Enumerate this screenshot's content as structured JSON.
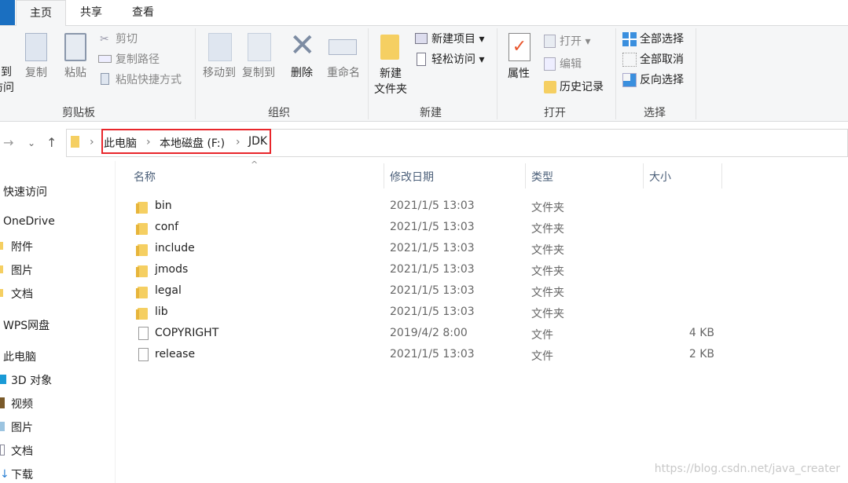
{
  "tabs": [
    "主页",
    "共享",
    "查看"
  ],
  "ribbon": {
    "pin": [
      "到",
      "访问"
    ],
    "copy": "复制",
    "paste": "粘贴",
    "cut": "剪切",
    "copy_path": "复制路径",
    "paste_shortcut": "粘贴快捷方式",
    "group_clipboard": "剪贴板",
    "move_to": "移动到",
    "copy_to": "复制到",
    "delete": "删除",
    "rename": "重命名",
    "group_organize": "组织",
    "new_folder": [
      "新建",
      "文件夹"
    ],
    "new_item": "新建项目",
    "easy_access": "轻松访问",
    "group_new": "新建",
    "properties": "属性",
    "open": "打开",
    "edit": "编辑",
    "history": "历史记录",
    "group_open": "打开",
    "select_all": "全部选择",
    "select_none": "全部取消",
    "invert_selection": "反向选择",
    "group_select": "选择"
  },
  "breadcrumb": [
    "此电脑",
    "本地磁盘 (F:)",
    "JDK"
  ],
  "highlight_color": "#e8262b",
  "sidebar": [
    "快速访问",
    "OneDrive",
    "附件",
    "图片",
    "文档",
    "WPS网盘",
    "此电脑",
    "3D 对象",
    "视频",
    "图片",
    "文档",
    "下载"
  ],
  "columns": [
    "名称",
    "修改日期",
    "类型",
    "大小"
  ],
  "files": [
    {
      "name": "bin",
      "date": "2021/1/5 13:03",
      "type": "文件夹",
      "size": "",
      "icon": "folder"
    },
    {
      "name": "conf",
      "date": "2021/1/5 13:03",
      "type": "文件夹",
      "size": "",
      "icon": "folder"
    },
    {
      "name": "include",
      "date": "2021/1/5 13:03",
      "type": "文件夹",
      "size": "",
      "icon": "folder"
    },
    {
      "name": "jmods",
      "date": "2021/1/5 13:03",
      "type": "文件夹",
      "size": "",
      "icon": "folder"
    },
    {
      "name": "legal",
      "date": "2021/1/5 13:03",
      "type": "文件夹",
      "size": "",
      "icon": "folder"
    },
    {
      "name": "lib",
      "date": "2021/1/5 13:03",
      "type": "文件夹",
      "size": "",
      "icon": "folder"
    },
    {
      "name": "COPYRIGHT",
      "date": "2019/4/2 8:00",
      "type": "文件",
      "size": "4 KB",
      "icon": "file"
    },
    {
      "name": "release",
      "date": "2021/1/5 13:03",
      "type": "文件",
      "size": "2 KB",
      "icon": "file"
    }
  ],
  "watermark": "https://blog.csdn.net/java_creater"
}
